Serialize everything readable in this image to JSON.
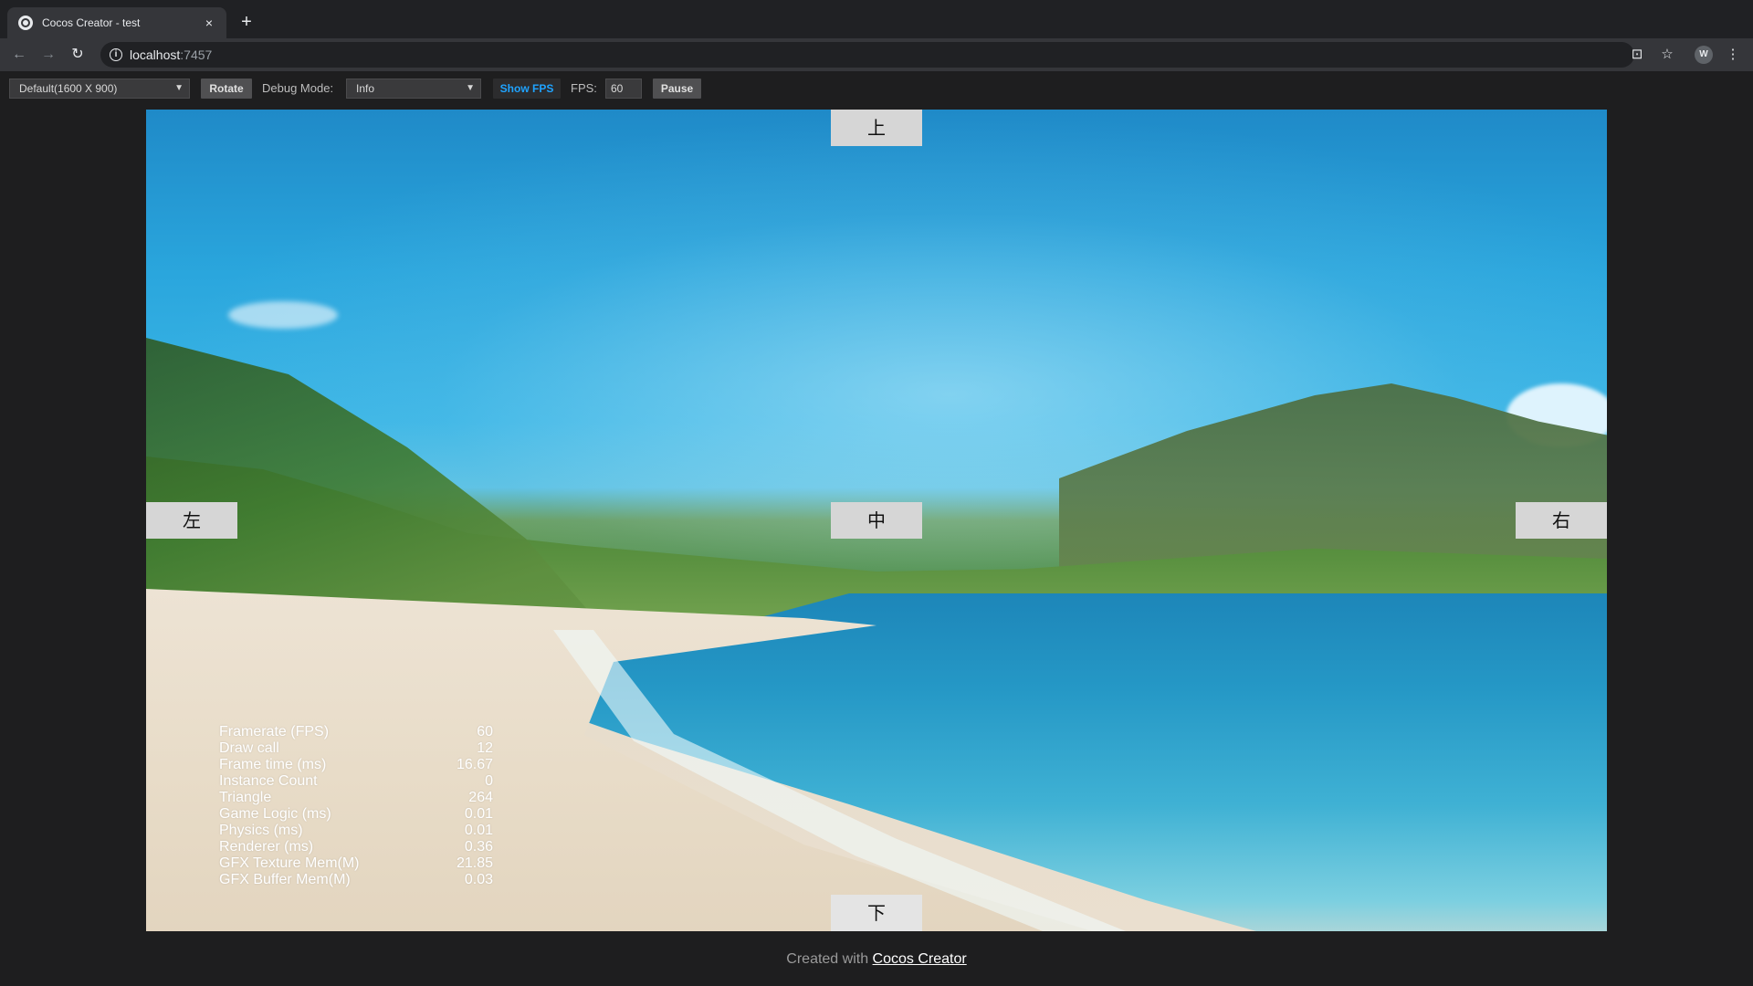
{
  "browser": {
    "tab_title": "Cocos Creator - test",
    "tab_close": "×",
    "new_tab": "+",
    "url_host": "localhost",
    "url_port": ":7457",
    "profile_initial": "W"
  },
  "preview_toolbar": {
    "resolution": "Default(1600 X 900)",
    "rotate_label": "Rotate",
    "debug_mode_label": "Debug Mode:",
    "debug_mode_value": "Info",
    "show_fps_label": "Show FPS",
    "fps_label": "FPS:",
    "fps_value": "60",
    "pause_label": "Pause"
  },
  "game": {
    "btn_up": "上",
    "btn_center": "中",
    "btn_left": "左",
    "btn_right": "右",
    "btn_down": "下"
  },
  "stats": [
    {
      "label": "Framerate (FPS)",
      "value": "60"
    },
    {
      "label": "Draw call",
      "value": "12"
    },
    {
      "label": "Frame time (ms)",
      "value": "16.67"
    },
    {
      "label": "Instance Count",
      "value": "0"
    },
    {
      "label": "Triangle",
      "value": "264"
    },
    {
      "label": "Game Logic (ms)",
      "value": "0.01"
    },
    {
      "label": "Physics (ms)",
      "value": "0.01"
    },
    {
      "label": "Renderer (ms)",
      "value": "0.36"
    },
    {
      "label": "GFX Texture Mem(M)",
      "value": "21.85"
    },
    {
      "label": "GFX Buffer Mem(M)",
      "value": "0.03"
    }
  ],
  "footer": {
    "prefix": "Created with ",
    "link": "Cocos Creator"
  },
  "colors": {
    "accent": "#1fa3ff",
    "chrome_bg": "#202124",
    "toolbar_bg": "#35363a",
    "page_bg": "#1e1e1f"
  }
}
